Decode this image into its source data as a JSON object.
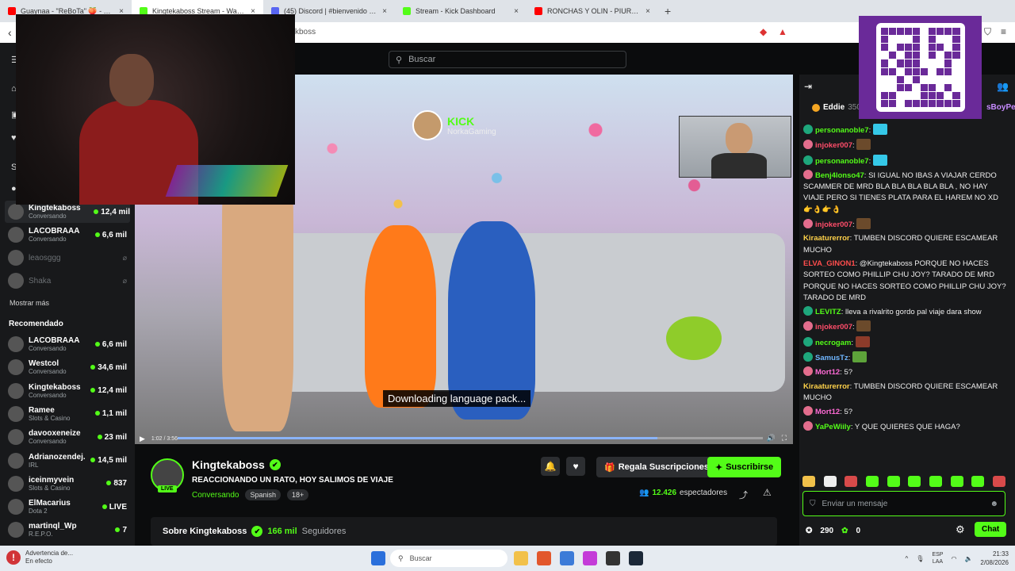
{
  "browser": {
    "tabs": [
      {
        "title": "Guaynaa - \"ReBoTa\" 🍑 - YouTube",
        "color": "#ff0000",
        "active": false
      },
      {
        "title": "Kingtekaboss Stream - Watch",
        "color": "#53fc18",
        "active": true
      },
      {
        "title": "(45) Discord | #bienvenido | EsSantt",
        "color": "#5865f2",
        "active": false
      },
      {
        "title": "Stream - Kick Dashboard",
        "color": "#53fc18",
        "active": false
      },
      {
        "title": "RONCHAS Y OLIN - PIURANO 27 ...",
        "color": "#ff0000",
        "active": false
      }
    ],
    "url": "kboss",
    "new_tab": "+"
  },
  "search": {
    "placeholder": "Buscar"
  },
  "sidebar": {
    "following": [
      {
        "name": "Kingtekaboss",
        "category": "Conversando",
        "viewers": "12,4 mil",
        "active": true,
        "live": true
      },
      {
        "name": "LACOBRAAA",
        "category": "Conversando",
        "viewers": "6,6 mil",
        "active": false,
        "live": true
      },
      {
        "name": "leaosggg",
        "category": "",
        "viewers": "",
        "active": false,
        "live": false
      },
      {
        "name": "Shaka",
        "category": "",
        "viewers": "",
        "active": false,
        "live": false
      }
    ],
    "show_more": "Mostrar más",
    "recommended_heading": "Recomendado",
    "recommended": [
      {
        "name": "LACOBRAAA",
        "category": "Conversando",
        "viewers": "6,6 mil"
      },
      {
        "name": "Westcol",
        "category": "Conversando",
        "viewers": "34,6 mil"
      },
      {
        "name": "Kingtekaboss",
        "category": "Conversando",
        "viewers": "12,4 mil"
      },
      {
        "name": "Ramee",
        "category": "Slots & Casino",
        "viewers": "1,1 mil"
      },
      {
        "name": "davooxeneize",
        "category": "Conversando",
        "viewers": "23 mil"
      },
      {
        "name": "Adrianozendej...",
        "category": "IRL",
        "viewers": "14,5 mil"
      },
      {
        "name": "iceinmyvein",
        "category": "Slots & Casino",
        "viewers": "837"
      },
      {
        "name": "ElMacarius",
        "category": "Dota 2",
        "viewers": "LIVE"
      },
      {
        "name": "martinql_Wp",
        "category": "R.E.P.O.",
        "viewers": "7"
      }
    ]
  },
  "video": {
    "watermark_kick": "KICK",
    "watermark_name": "NorkaGaming",
    "caption": "Downloading language pack...",
    "time": "1:02 / 3:56",
    "progress": 0.82
  },
  "stream": {
    "streamer": "Kingtekaboss",
    "live_badge": "LIVE",
    "title": "REACCIONANDO UN RATO, HOY SALIMOS DE VIAJE",
    "category": "Conversando",
    "language": "Spanish",
    "age": "18+",
    "gift_label": "Regala Suscripciones",
    "subscribe_label": "Suscribirse",
    "viewers": "12.426",
    "viewers_label": "espectadores",
    "about_label": "Sobre Kingtekaboss",
    "followers": "166 mil",
    "followers_label": "Seguidores"
  },
  "chat": {
    "pinned_user": "Eddie",
    "pinned_num": "350",
    "pinned_tail": "sBoyPe",
    "messages": [
      {
        "user": "personanoble7",
        "text": "",
        "color": "#53fc18",
        "badge": "#1ea77c",
        "emote": "#35c8e8"
      },
      {
        "user": "injoker007",
        "text": "",
        "color": "#ff4d6a",
        "badge": "#e36d8d",
        "emote": "#6b4a2b"
      },
      {
        "user": "personanoble7",
        "text": "",
        "color": "#53fc18",
        "badge": "#1ea77c",
        "emote": "#35c8e8"
      },
      {
        "user": "Benj4lonso47",
        "text": "SI IGUAL NO IBAS A VIAJAR CERDO SCAMMER DE MRD BLA BLA BLA BLA BLA , NO HAY VIAJE PERO SI TIENES PLATA PARA EL HAREM NO XD 👉👌👉👌",
        "color": "#53fc18",
        "badge": "#e36d8d",
        "emote": ""
      },
      {
        "user": "injoker007",
        "text": "",
        "color": "#ff4d6a",
        "badge": "#e36d8d",
        "emote": "#6b4a2b"
      },
      {
        "user": "Kiraaturerror",
        "text": "TUMBEN DISCORD QUIERE ESCAMEAR MUCHO",
        "color": "#ffd24a",
        "badge": "",
        "emote": ""
      },
      {
        "user": "ELVA_GINON1",
        "text": "@Kingtekaboss PORQUE NO HACES SORTEO COMO PHILLIP CHU JOY? TARADO DE MRD PORQUE NO HACES SORTEO COMO PHILLIP CHU JOY? TARADO DE MRD",
        "color": "#ff4d4d",
        "badge": "",
        "emote": ""
      },
      {
        "user": "LEVITZ",
        "text": "lleva a rivalrito gordo pal viaje dara show",
        "color": "#53fc18",
        "badge": "#1ea77c",
        "emote": ""
      },
      {
        "user": "injoker007",
        "text": "",
        "color": "#ff4d6a",
        "badge": "#e36d8d",
        "emote": "#6b4a2b"
      },
      {
        "user": "necrogam",
        "text": "",
        "color": "#53fc18",
        "badge": "#1ea77c",
        "emote": "#8c3b2a"
      },
      {
        "user": "SamusTz",
        "text": "",
        "color": "#6fb6ff",
        "badge": "#1ea77c",
        "emote": "#5da33a"
      },
      {
        "user": "Mort12",
        "text": "5?",
        "color": "#ff6ad5",
        "badge": "#e36d8d",
        "emote": ""
      },
      {
        "user": "Kiraaturerror",
        "text": "TUMBEN DISCORD QUIERE ESCAMEAR MUCHO",
        "color": "#ffd24a",
        "badge": "",
        "emote": ""
      },
      {
        "user": "Mort12",
        "text": "5?",
        "color": "#ff6ad5",
        "badge": "#e36d8d",
        "emote": ""
      },
      {
        "user": "YaPeWiily",
        "text": "Y QUE QUIERES QUE HAGA?",
        "color": "#53fc18",
        "badge": "#e36d8d",
        "emote": ""
      }
    ],
    "input_placeholder": "Enviar un mensaje",
    "points": "290",
    "kicks": "0",
    "chat_button": "Chat"
  },
  "taskbar": {
    "warning_title": "Advertencia de...",
    "warning_sub": "En efecto",
    "search": "Buscar",
    "lang_top": "ESP",
    "lang_bottom": "LAA",
    "time": "21:33",
    "date": "2/08/2026"
  }
}
